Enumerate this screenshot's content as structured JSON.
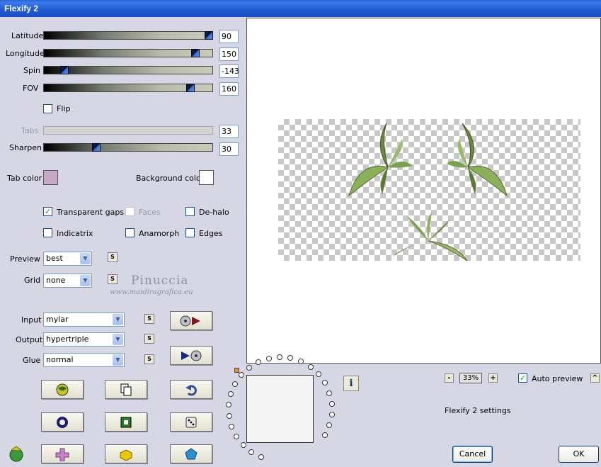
{
  "window": {
    "title": "Flexify 2"
  },
  "sliders": [
    {
      "label": "Latitude",
      "value": "90",
      "level": 0.98,
      "enabled": true
    },
    {
      "label": "Longitude",
      "value": "150",
      "level": 0.9,
      "enabled": true
    },
    {
      "label": "Spin",
      "value": "-143",
      "level": 0.12,
      "enabled": true
    },
    {
      "label": "FOV",
      "value": "160",
      "level": 0.87,
      "enabled": true
    },
    {
      "label": "Tabs",
      "value": "33",
      "level": null,
      "enabled": false
    },
    {
      "label": "Sharpen",
      "value": "30",
      "level": 0.31,
      "enabled": true
    }
  ],
  "flip": {
    "label": "Flip",
    "checked": false
  },
  "colors": {
    "tab_label": "Tab color",
    "tab_value": "#c8a8c8",
    "background_label": "Background color",
    "background_value": "#ffffff"
  },
  "options": {
    "transparent_gaps": {
      "label": "Transparent gaps",
      "checked": true
    },
    "faces": {
      "label": "Faces",
      "checked": false,
      "enabled": false
    },
    "dehalo": {
      "label": "De-halo",
      "checked": false
    },
    "indicatrix": {
      "label": "Indicatrix",
      "checked": false
    },
    "anamorph": {
      "label": "Anamorph",
      "checked": false
    },
    "edges": {
      "label": "Edges",
      "checked": false
    }
  },
  "preview_select": {
    "label": "Preview",
    "value": "best"
  },
  "grid_select": {
    "label": "Grid",
    "value": "none"
  },
  "input_select": {
    "label": "Input",
    "value": "mylar"
  },
  "output_select": {
    "label": "Output",
    "value": "hypertriple"
  },
  "glue_select": {
    "label": "Glue",
    "value": "normal"
  },
  "small_button_label": "S",
  "watermark": {
    "name": "Pinuccia",
    "site": "www.maidiragrafica.eu"
  },
  "zoom": {
    "minus": "-",
    "value": "33%",
    "plus": "+"
  },
  "auto_preview": {
    "label": "Auto preview",
    "checked": true
  },
  "collapse_label": "^",
  "status_text": "Flexify 2 settings",
  "info_label": "i",
  "buttons": {
    "cancel": "Cancel",
    "ok": "OK"
  },
  "icons": [
    "load-preset-icon",
    "copy-icon",
    "undo-icon",
    "circle-icon",
    "square-frame-icon",
    "dice-icon",
    "plus-icon",
    "cube-icon",
    "pentagon-icon",
    "play-input-icon",
    "play-output-icon",
    "app-logo-icon"
  ]
}
